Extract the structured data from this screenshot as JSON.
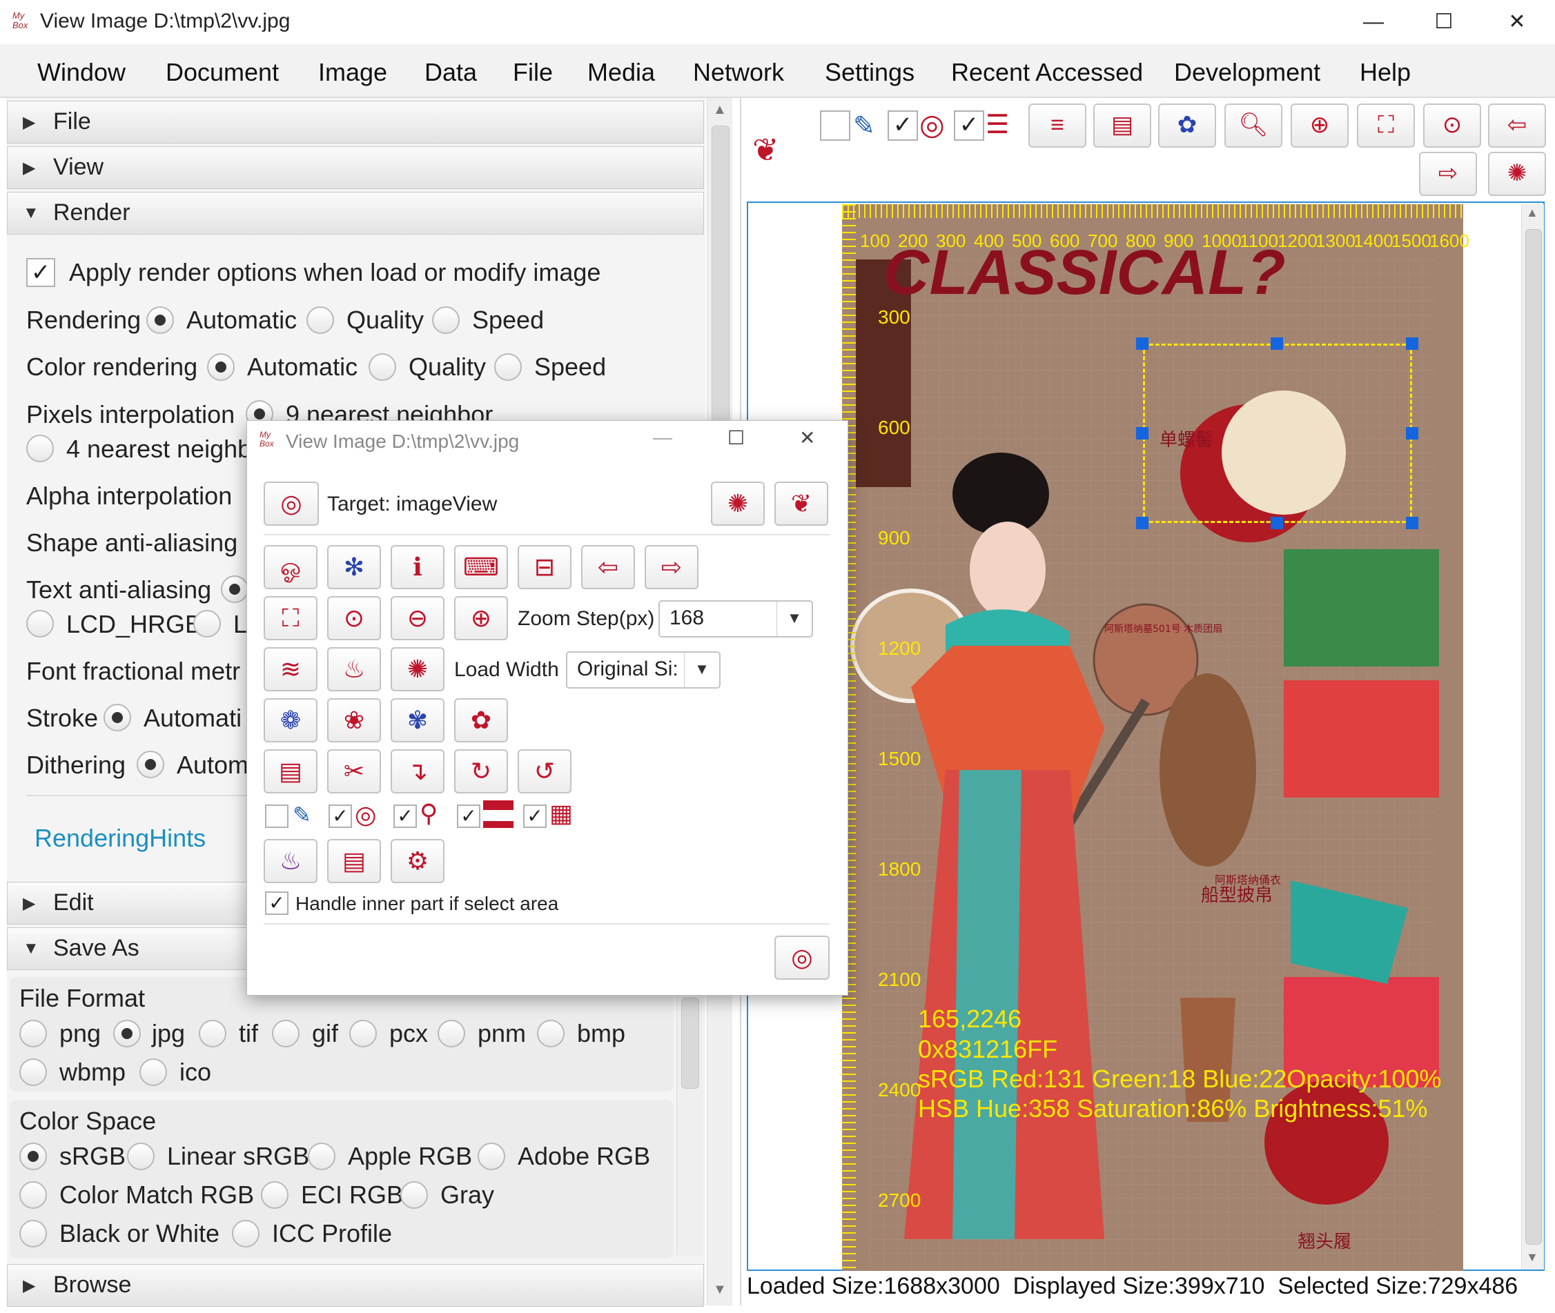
{
  "window": {
    "title": "View Image D:\\tmp\\2\\vv.jpg",
    "logo_text": "My Box",
    "minimize": "—",
    "maximize": "☐",
    "close": "✕"
  },
  "menu": [
    "Window",
    "Document",
    "Image",
    "Data",
    "File",
    "Media",
    "Network",
    "Settings",
    "Recent Accessed",
    "Development",
    "Help"
  ],
  "left": {
    "sections": {
      "file": "File",
      "view": "View",
      "render": "Render",
      "edit": "Edit",
      "save_as": "Save As",
      "browse": "Browse"
    },
    "render": {
      "apply_label": "Apply render options when load or modify image",
      "rendering_label": "Rendering",
      "color_rendering_label": "Color rendering",
      "pixels_interp_label": "Pixels interpolation",
      "alpha_interp_label": "Alpha interpolation",
      "shape_aa_label": "Shape anti-aliasing",
      "text_aa_label": "Text anti-aliasing",
      "font_frac_label": "Font fractional metr",
      "stroke_label": "Stroke",
      "dithering_label": "Dithering",
      "opt_automatic": "Automatic",
      "opt_quality": "Quality",
      "opt_speed": "Speed",
      "opt_9nn": "9 nearest neighbor",
      "opt_4nn": "4 nearest neighb",
      "opt_lcd_hrgb": "LCD_HRGB",
      "opt_l": "L",
      "opt_automati": "Automati",
      "opt_autom": "Autom",
      "hints_link": "RenderingHints"
    },
    "save_as": {
      "file_format_label": "File Format",
      "formats": [
        "png",
        "jpg",
        "tif",
        "gif",
        "pcx",
        "pnm",
        "bmp",
        "wbmp",
        "ico"
      ],
      "selected_format": "jpg",
      "color_space_label": "Color Space",
      "spaces": [
        "sRGB",
        "Linear sRGB",
        "Apple RGB",
        "Adobe RGB",
        "Color Match RGB",
        "ECI RGB",
        "Gray",
        "Black or White",
        "ICC Profile"
      ],
      "selected_space": "sRGB"
    }
  },
  "ruler": {
    "h_ticks": [
      "100",
      "200",
      "300",
      "400",
      "500",
      "600",
      "700",
      "800",
      "900",
      "1000",
      "1100",
      "1200",
      "1300",
      "1400",
      "1500",
      "1600"
    ],
    "v_ticks": [
      "300",
      "600",
      "900",
      "1200",
      "1500",
      "1800",
      "2100",
      "2400",
      "2700"
    ]
  },
  "poster": {
    "headline": "CLASSICAL?",
    "label_bun": "单螺髻",
    "label_shawl": "船型披帛",
    "label_fan": "阿斯塔纳墓501号 木质团扇",
    "label_shoe": "翘头履",
    "label_museum": "阿斯塔纳俑衣"
  },
  "readout": {
    "coords": "165,2246",
    "hex": "0x831216FF",
    "srgb": "sRGB  Red:131 Green:18 Blue:22Opacity:100%",
    "hsb": "HSB  Hue:358 Saturation:86% Brightness:51%"
  },
  "status": {
    "loaded": "Loaded Size:1688x3000",
    "displayed": "Displayed Size:399x710",
    "selected": "Selected Size:729x486"
  },
  "dialog": {
    "title": "View Image D:\\tmp\\2\\vv.jpg",
    "target": "Target: imageView",
    "zoom_step_label": "Zoom Step(px)",
    "zoom_step_value": "168",
    "load_width_label": "Load Width",
    "load_width_value": "Original Si:",
    "handle_inner": "Handle inner part if select area"
  },
  "colors": {
    "accent": "#c0142a",
    "ruler": "#ffe600",
    "selection": "#ffe600",
    "handle": "#1565e0",
    "poster_bg": "#a38470",
    "headline": "#8a1020",
    "border_blue": "#2a8fd8"
  }
}
